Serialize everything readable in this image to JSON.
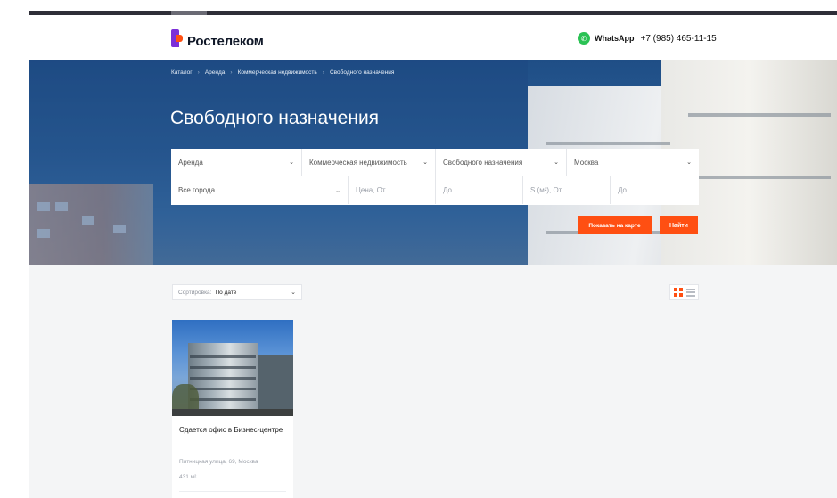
{
  "header": {
    "brand": "Ростелеком",
    "whatsapp_label": "WhatsApp",
    "phone": "+7 (985) 465-11-15"
  },
  "breadcrumb": [
    "Каталог",
    "Аренда",
    "Коммерческая недвижимость",
    "Свободного назначения"
  ],
  "page_title": "Свободного назначения",
  "filters": {
    "deal_type": "Аренда",
    "category": "Коммерческая недвижимость",
    "subcategory": "Свободного назначения",
    "region": "Москва",
    "city": "Все города",
    "price_from_placeholder": "Цена, От",
    "price_to_placeholder": "До",
    "area_from_placeholder": "S (м²), От",
    "area_to_placeholder": "До"
  },
  "buttons": {
    "show_on_map": "Показать на карте",
    "find": "Найти"
  },
  "sort": {
    "label": "Сортировка:",
    "value": "По дате"
  },
  "listings": [
    {
      "title": "Сдается офис в Бизнес-центре",
      "address": "Пятницкая улица, 69, Москва",
      "area": "431 м²"
    }
  ],
  "colors": {
    "accent": "#ff4f12",
    "brand_purple": "#7b2fd8",
    "whatsapp": "#2bc254"
  }
}
